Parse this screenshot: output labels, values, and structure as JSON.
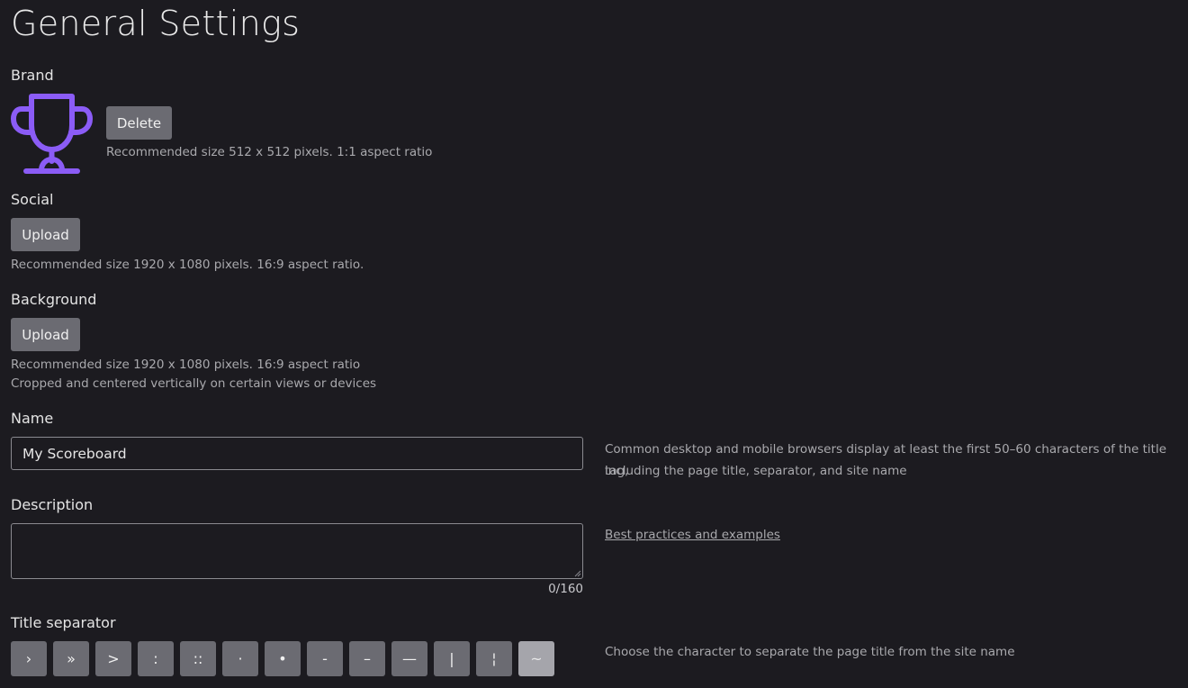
{
  "page": {
    "title": "General Settings"
  },
  "brand": {
    "label": "Brand",
    "delete_label": "Delete",
    "hint": "Recommended size 512 x 512 pixels. 1:1 aspect ratio",
    "logo_icon": "trophy-icon",
    "logo_color": "#8b5cf6"
  },
  "social": {
    "label": "Social",
    "upload_label": "Upload",
    "hint": "Recommended size 1920 x 1080 pixels. 16:9 aspect ratio."
  },
  "background": {
    "label": "Background",
    "upload_label": "Upload",
    "hint1": "Recommended size 1920 x 1080 pixels. 16:9 aspect ratio",
    "hint2": "Cropped and centered vertically on certain views or devices"
  },
  "name": {
    "label": "Name",
    "value": "My Scoreboard",
    "hint1": "Common desktop and mobile browsers display at least the first 50–60 characters of the title tag,",
    "hint2": "including the page title, separator, and site name"
  },
  "description": {
    "label": "Description",
    "value": "",
    "counter": "0/160",
    "link": "Best practices and examples"
  },
  "separator": {
    "label": "Title separator",
    "hint": "Choose the character to separate the page title from the site name",
    "options": [
      "›",
      "»",
      ">",
      ":",
      "::",
      "·",
      "•",
      "-",
      "–",
      "—",
      "|",
      "¦",
      "~"
    ],
    "selected": "~"
  }
}
